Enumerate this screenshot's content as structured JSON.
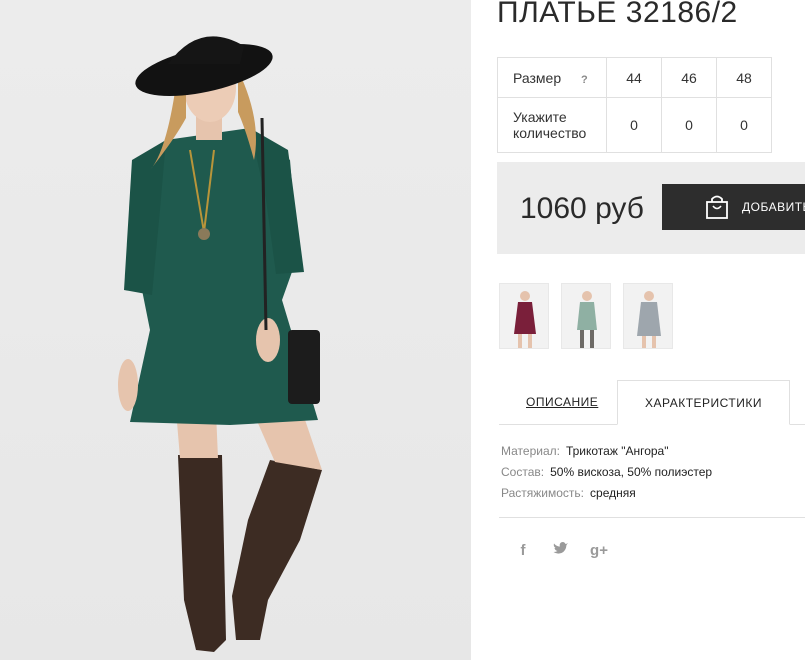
{
  "product": {
    "title": "ПЛАТЬЕ 32186/2",
    "photo_alt": "main-product-photo"
  },
  "size_table": {
    "size_label": "Размер",
    "help_icon": "?",
    "sizes": [
      "44",
      "46",
      "48"
    ],
    "qty_label": "Укажите количество",
    "quantities": [
      "0",
      "0",
      "0"
    ]
  },
  "purchase": {
    "price": "1060 руб",
    "add_button_label": "ДОБАВИТЬ"
  },
  "thumbnails": [
    {
      "name": "thumb-burgundy",
      "color": "#7a1f3a"
    },
    {
      "name": "thumb-mint",
      "color": "#8fb0a3"
    },
    {
      "name": "thumb-grey",
      "color": "#9ea6ad"
    }
  ],
  "tabs": {
    "description": "ОПИСАНИЕ",
    "characteristics": "ХАРАКТЕРИСТИКИ"
  },
  "specs": [
    {
      "key": "Материал:",
      "value": "Трикотаж \"Ангора\""
    },
    {
      "key": "Состав:",
      "value": "50% вискоза, 50% полиэстер"
    },
    {
      "key": "Растяжимость:",
      "value": "средняя"
    }
  ],
  "social": {
    "facebook": "f",
    "twitter": "t",
    "google": "g+"
  },
  "colors": {
    "dress": "#1f5a4e",
    "price_bg": "#ececec",
    "button_bg": "#2d2d2d"
  }
}
